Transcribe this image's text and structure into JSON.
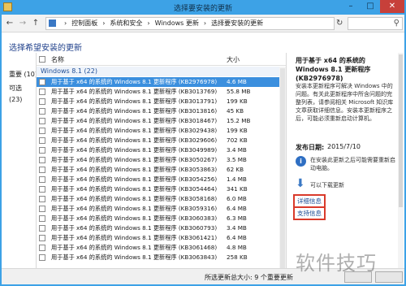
{
  "window": {
    "title": "选择要安装的更新"
  },
  "addressbar": {
    "crumbs": [
      "控制面板",
      "系统和安全",
      "Windows 更新",
      "选择要安装的更新"
    ],
    "separator": "›"
  },
  "page": {
    "heading": "选择希望安装的更新"
  },
  "tabs": {
    "important": "重要 (10)",
    "optional": "可选 (23)"
  },
  "table": {
    "col_name": "名称",
    "col_size": "大小",
    "group": "Windows 8.1 (22)",
    "rows": [
      {
        "name": "用于基于 x64 的系统的 Windows 8.1 更新程序 (KB2976978)",
        "size": "4.6 MB",
        "selected": true
      },
      {
        "name": "用于基于 x64 的系统的 Windows 8.1 更新程序 (KB3013769)",
        "size": "55.8 MB"
      },
      {
        "name": "用于基于 x64 的系统的 Windows 8.1 更新程序 (KB3013791)",
        "size": "199 KB"
      },
      {
        "name": "用于基于 x64 的系统的 Windows 8.1 更新程序 (KB3013816)",
        "size": "45 KB"
      },
      {
        "name": "用于基于 x64 的系统的 Windows 8.1 更新程序 (KB3018467)",
        "size": "15.2 MB"
      },
      {
        "name": "用于基于 x64 的系统的 Windows 8.1 更新程序 (KB3029438)",
        "size": "199 KB"
      },
      {
        "name": "用于基于 x64 的系统的 Windows 8.1 更新程序 (KB3029606)",
        "size": "702 KB"
      },
      {
        "name": "用于基于 x64 的系统的 Windows 8.1 更新程序 (KB3049989)",
        "size": "3.4 MB"
      },
      {
        "name": "用于基于 x64 的系统的 Windows 8.1 更新程序 (KB3050267)",
        "size": "3.5 MB"
      },
      {
        "name": "用于基于 x64 的系统的 Windows 8.1 更新程序 (KB3053863)",
        "size": "62 KB"
      },
      {
        "name": "用于基于 x64 的系统的 Windows 8.1 更新程序 (KB3054256)",
        "size": "1.4 MB"
      },
      {
        "name": "用于基于 x64 的系统的 Windows 8.1 更新程序 (KB3054464)",
        "size": "341 KB"
      },
      {
        "name": "用于基于 x64 的系统的 Windows 8.1 更新程序 (KB3058168)",
        "size": "6.0 MB"
      },
      {
        "name": "用于基于 x64 的系统的 Windows 8.1 更新程序 (KB3059316)",
        "size": "6.4 MB"
      },
      {
        "name": "用于基于 x64 的系统的 Windows 8.1 更新程序 (KB3060383)",
        "size": "6.3 MB"
      },
      {
        "name": "用于基于 x64 的系统的 Windows 8.1 更新程序 (KB3060793)",
        "size": "3.4 MB"
      },
      {
        "name": "用于基于 x64 的系统的 Windows 8.1 更新程序 (KB3061421)",
        "size": "6.4 MB"
      },
      {
        "name": "用于基于 x64 的系统的 Windows 8.1 更新程序 (KB3061468)",
        "size": "4.8 MB"
      },
      {
        "name": "用于基于 x64 的系统的 Windows 8.1 更新程序 (KB3063843)",
        "size": "258 KB"
      }
    ]
  },
  "details": {
    "title": "用于基于 x64 的系统的 Windows 8.1 更新程序 (KB2976978)",
    "description": "安装本更新程序可解决 Windows 中的问题。有关此更新程序中所含问题的完整列表，请参阅相关 Microsoft 知识库文章获取详细信息。安装本更新程序之后，可能必须重新启动计算机。",
    "date_label": "发布日期:",
    "date_value": "2015/7/10",
    "restart_note": "在安装此更新之后可能需要重新启动电脑。",
    "download_note": "可以下载更新",
    "link_more": "详细信息",
    "link_support": "支持信息"
  },
  "status": {
    "text": "所选更新总大小: 9 个重要更新"
  },
  "watermark": "软件技巧",
  "icons": {
    "app": "control-panel-icon",
    "refresh": "refresh-icon",
    "search": "search-icon",
    "info": "info-icon",
    "download": "download-arrow-icon"
  },
  "colors": {
    "title_bar": "#3da2e6",
    "selection": "#3b8fde",
    "link": "#1e4d96",
    "highlight_box": "#d93a2b"
  }
}
